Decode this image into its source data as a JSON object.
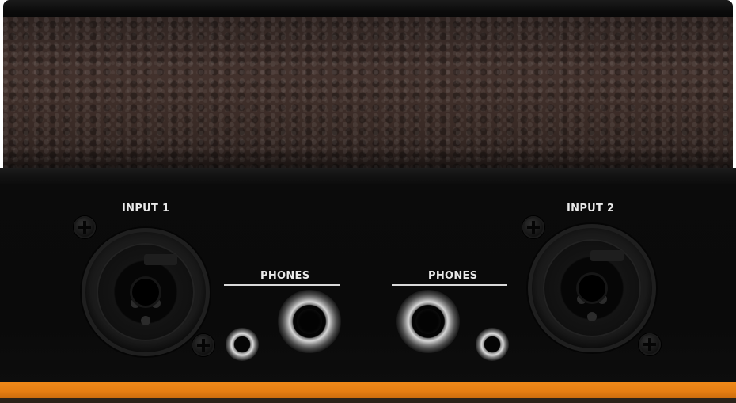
{
  "labels": {
    "input_1": "INPUT 1",
    "input_2": "INPUT 2",
    "phones_left": "PHONES",
    "phones_right": "PHONES"
  },
  "colors": {
    "accent_strip": "#e67e12",
    "panel": "#0a0a0a",
    "leather": "#3a2b27",
    "label_text": "#e9e9e9"
  }
}
